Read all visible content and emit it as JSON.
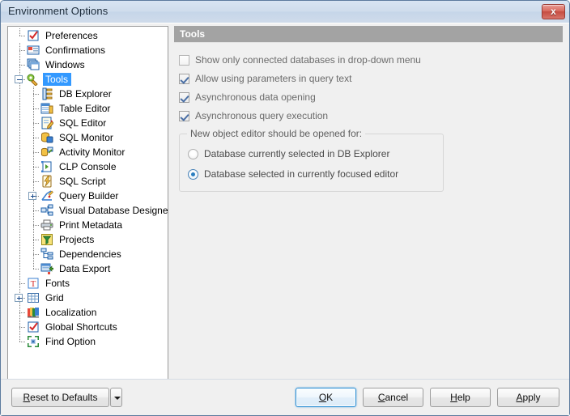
{
  "window": {
    "title": "Environment Options",
    "close_label": "x"
  },
  "tree": {
    "items": [
      {
        "label": "Preferences",
        "icon": "preferences-icon",
        "indent": 0,
        "expander": "none",
        "selected": false,
        "connector": "elbow"
      },
      {
        "label": "Confirmations",
        "icon": "confirmations-icon",
        "indent": 0,
        "expander": "none",
        "selected": false,
        "connector": "tee"
      },
      {
        "label": "Windows",
        "icon": "windows-icon",
        "indent": 0,
        "expander": "none",
        "selected": false,
        "connector": "tee"
      },
      {
        "label": "Tools",
        "icon": "tools-icon",
        "indent": 0,
        "expander": "minus",
        "selected": true,
        "connector": "tee"
      },
      {
        "label": "DB Explorer",
        "icon": "db-explorer-icon",
        "indent": 1,
        "expander": "none",
        "selected": false,
        "connector": "tee"
      },
      {
        "label": "Table Editor",
        "icon": "table-editor-icon",
        "indent": 1,
        "expander": "none",
        "selected": false,
        "connector": "tee"
      },
      {
        "label": "SQL Editor",
        "icon": "sql-editor-icon",
        "indent": 1,
        "expander": "none",
        "selected": false,
        "connector": "tee"
      },
      {
        "label": "SQL Monitor",
        "icon": "sql-monitor-icon",
        "indent": 1,
        "expander": "none",
        "selected": false,
        "connector": "tee"
      },
      {
        "label": "Activity Monitor",
        "icon": "activity-monitor-icon",
        "indent": 1,
        "expander": "none",
        "selected": false,
        "connector": "tee"
      },
      {
        "label": "CLP Console",
        "icon": "clp-console-icon",
        "indent": 1,
        "expander": "none",
        "selected": false,
        "connector": "tee"
      },
      {
        "label": "SQL Script",
        "icon": "sql-script-icon",
        "indent": 1,
        "expander": "none",
        "selected": false,
        "connector": "tee"
      },
      {
        "label": "Query Builder",
        "icon": "query-builder-icon",
        "indent": 1,
        "expander": "plus",
        "selected": false,
        "connector": "tee"
      },
      {
        "label": "Visual Database Designer",
        "icon": "visual-database-designer-icon",
        "indent": 1,
        "expander": "none",
        "selected": false,
        "connector": "tee"
      },
      {
        "label": "Print Metadata",
        "icon": "print-metadata-icon",
        "indent": 1,
        "expander": "none",
        "selected": false,
        "connector": "tee"
      },
      {
        "label": "Projects",
        "icon": "projects-icon",
        "indent": 1,
        "expander": "none",
        "selected": false,
        "connector": "tee"
      },
      {
        "label": "Dependencies",
        "icon": "dependencies-icon",
        "indent": 1,
        "expander": "none",
        "selected": false,
        "connector": "tee"
      },
      {
        "label": "Data Export",
        "icon": "data-export-icon",
        "indent": 1,
        "expander": "none",
        "selected": false,
        "connector": "elbow-end"
      },
      {
        "label": "Fonts",
        "icon": "fonts-icon",
        "indent": 0,
        "expander": "none",
        "selected": false,
        "connector": "tee"
      },
      {
        "label": "Grid",
        "icon": "grid-icon",
        "indent": 0,
        "expander": "plus",
        "selected": false,
        "connector": "tee"
      },
      {
        "label": "Localization",
        "icon": "localization-icon",
        "indent": 0,
        "expander": "none",
        "selected": false,
        "connector": "tee"
      },
      {
        "label": "Global Shortcuts",
        "icon": "global-shortcuts-icon",
        "indent": 0,
        "expander": "none",
        "selected": false,
        "connector": "tee"
      },
      {
        "label": "Find Option",
        "icon": "find-option-icon",
        "indent": 0,
        "expander": "none",
        "selected": false,
        "connector": "elbow-end"
      }
    ]
  },
  "panel": {
    "header": "Tools",
    "checkboxes": [
      {
        "label": "Show only connected databases in drop-down menu",
        "checked": false
      },
      {
        "label": "Allow using parameters in query text",
        "checked": true
      },
      {
        "label": "Asynchronous data opening",
        "checked": true
      },
      {
        "label": "Asynchronous query execution",
        "checked": true
      }
    ],
    "group": {
      "legend": "New object editor should be opened for:",
      "options": [
        {
          "label": "Database currently selected in DB Explorer",
          "selected": false
        },
        {
          "label": "Database selected in currently focused editor",
          "selected": true
        }
      ]
    }
  },
  "footer": {
    "reset": {
      "pre": "",
      "accel": "R",
      "post": "eset to Defaults"
    },
    "ok": {
      "pre": "",
      "accel": "O",
      "post": "K"
    },
    "cancel": {
      "pre": "",
      "accel": "C",
      "post": "ancel"
    },
    "help": {
      "pre": "",
      "accel": "H",
      "post": "elp"
    },
    "apply": {
      "pre": "",
      "accel": "A",
      "post": "pply"
    }
  },
  "colors": {
    "selection": "#3399ff",
    "header_bg": "#a3a3a3",
    "accent": "#2b7ec0",
    "close_red": "#c54c41"
  }
}
